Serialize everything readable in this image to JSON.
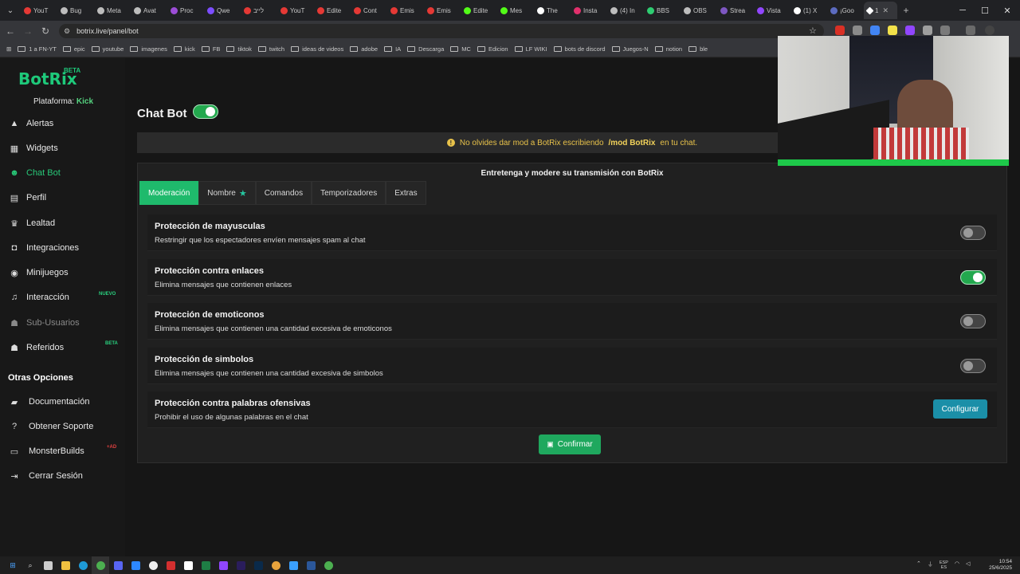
{
  "browser": {
    "tabs": [
      {
        "label": "YouT",
        "color": "#e53935"
      },
      {
        "label": "Bug",
        "color": "#bdbdbd"
      },
      {
        "label": "Meta",
        "color": "#bdbdbd"
      },
      {
        "label": "Avat",
        "color": "#bdbdbd"
      },
      {
        "label": "Proc",
        "color": "#9c4dd6"
      },
      {
        "label": "Qwe",
        "color": "#7c4dff"
      },
      {
        "label": "לייב",
        "color": "#e53935"
      },
      {
        "label": "YouT",
        "color": "#e53935"
      },
      {
        "label": "Edite",
        "color": "#e53935"
      },
      {
        "label": "Cont",
        "color": "#e53935"
      },
      {
        "label": "Emis",
        "color": "#e53935"
      },
      {
        "label": "Emis",
        "color": "#e53935"
      },
      {
        "label": "Edite",
        "color": "#53fc18"
      },
      {
        "label": "Mes",
        "color": "#53fc18"
      },
      {
        "label": "The",
        "color": "#ffffff"
      },
      {
        "label": "Insta",
        "color": "#e1306c"
      },
      {
        "label": "(4) In",
        "color": "#bdbdbd"
      },
      {
        "label": "BBS",
        "color": "#2ecc71"
      },
      {
        "label": "OBS",
        "color": "#bdbdbd"
      },
      {
        "label": "Strea",
        "color": "#7e57c2"
      },
      {
        "label": "Vista",
        "color": "#9146ff"
      },
      {
        "label": "(1) X",
        "color": "#ffffff"
      },
      {
        "label": "¡Goo",
        "color": "#5c6bc0"
      }
    ],
    "active_tab_label": "1",
    "new_tab": "+",
    "url": "botrix.live/panel/bot",
    "bookmarks": [
      "1 a FN-YT",
      "epic",
      "youtube",
      "imagenes",
      "kick",
      "FB",
      "tiktok",
      "twitch",
      "ideas de videos",
      "adobe",
      "IA",
      "Descarga",
      "MC",
      "Edicion",
      "LF WIKI",
      "bots de discord",
      "Juegos-N",
      "notion",
      "ble"
    ]
  },
  "sidebar": {
    "logo": "BotRix",
    "logo_badge": "BETA",
    "platform_label": "Plataforma:",
    "platform_value": "Kick",
    "items": [
      {
        "label": "Alertas",
        "icon": "bell-icon"
      },
      {
        "label": "Widgets",
        "icon": "grid-icon"
      },
      {
        "label": "Chat Bot",
        "icon": "robot-icon"
      },
      {
        "label": "Perfil",
        "icon": "id-card-icon"
      },
      {
        "label": "Lealtad",
        "icon": "trophy-icon"
      },
      {
        "label": "Integraciones",
        "icon": "plug-icon"
      },
      {
        "label": "Minijuegos",
        "icon": "gamepad-icon"
      },
      {
        "label": "Interacción",
        "icon": "music-icon"
      },
      {
        "label": "Sub-Usuarios",
        "icon": "users-icon"
      },
      {
        "label": "Referidos",
        "icon": "user-group-icon"
      }
    ],
    "badge_nuevo": "NUEVO",
    "badge_beta": "BETA",
    "other_title": "Otras Opciones",
    "other_items": [
      {
        "label": "Documentación",
        "icon": "book-icon"
      },
      {
        "label": "Obtener Soporte",
        "icon": "help-icon"
      },
      {
        "label": "MonsterBuilds",
        "icon": "laptop-icon"
      },
      {
        "label": "Cerrar Sesión",
        "icon": "logout-icon"
      }
    ],
    "badge_ad": "+AD"
  },
  "main": {
    "title": "Chat Bot",
    "bot_enabled": true,
    "notice_pre": "No olvides dar mod a BotRix escribiendo",
    "notice_cmd": "/mod BotRix",
    "notice_post": "en tu chat.",
    "panel_title": "Entretenga y modere su transmisión con BotRix",
    "tabs": [
      "Moderación",
      "Nombre",
      "Comandos",
      "Temporizadores",
      "Extras"
    ],
    "rows": [
      {
        "title": "Protección de mayusculas",
        "desc": "Restringir que los espectadores envíen mensajes spam al chat",
        "enabled": false
      },
      {
        "title": "Protección contra enlaces",
        "desc": "Elimina mensajes que contienen enlaces",
        "enabled": true
      },
      {
        "title": "Protección de emoticonos",
        "desc": "Elimina mensajes que contienen una cantidad excesiva de emoticonos",
        "enabled": false
      },
      {
        "title": "Protección de simbolos",
        "desc": "Elimina mensajes que contienen una cantidad excesiva de simbolos",
        "enabled": false
      },
      {
        "title": "Protección contra palabras ofensivas",
        "desc": "Prohibir el uso de algunas palabras en el chat"
      }
    ],
    "configure_label": "Configurar",
    "confirm_label": "Confirmar"
  },
  "taskbar": {
    "lang_top": "ESP",
    "lang_bottom": "ES",
    "time": "10:54",
    "date": "25/6/2025"
  }
}
